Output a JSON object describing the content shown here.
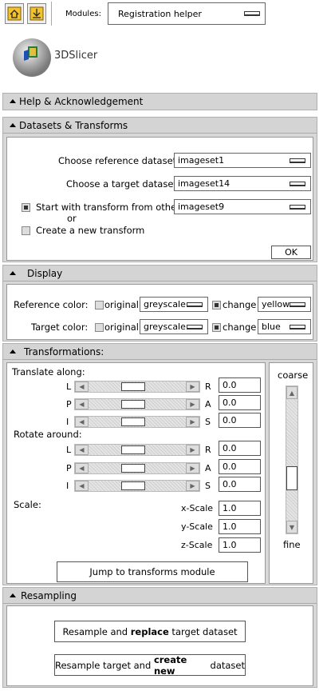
{
  "toolbar": {
    "home_icon": "home-icon",
    "save_icon": "save-icon",
    "modules_label": "Modules:",
    "modules_value": "Registration helper"
  },
  "logo": {
    "text": "3DSlicer"
  },
  "sections": {
    "help": {
      "title": "Help & Acknowledgement"
    },
    "datasets": {
      "title": "Datasets & Transforms",
      "ref_label": "Choose reference dataset:",
      "ref_value": "imageset1",
      "target_label": "Choose a target dataset:",
      "target_value": "imageset14",
      "start_label": "Start with transform from other:",
      "start_value": "imageset9",
      "or_label": "or",
      "create_label": "Create a new transform",
      "ok_label": "OK"
    },
    "display": {
      "title": "Display",
      "ref_color_label": "Reference color:",
      "target_color_label": "Target color:",
      "original_label": "original",
      "change_label": "change",
      "ref_original_value": "greyscale",
      "ref_change_value": "yellow",
      "target_original_value": "greyscale",
      "target_change_value": "blue"
    },
    "transformations": {
      "title": "Transformations:",
      "translate_label": "Translate along:",
      "rotate_label": "Rotate around:",
      "scale_label": "Scale:",
      "translate": [
        {
          "left": "L",
          "right": "R",
          "value": "0.0"
        },
        {
          "left": "P",
          "right": "A",
          "value": "0.0"
        },
        {
          "left": "I",
          "right": "S",
          "value": "0.0"
        }
      ],
      "rotate": [
        {
          "left": "L",
          "right": "R",
          "value": "0.0"
        },
        {
          "left": "P",
          "right": "A",
          "value": "0.0"
        },
        {
          "left": "I",
          "right": "S",
          "value": "0.0"
        }
      ],
      "scales": [
        {
          "label": "x-Scale",
          "value": "1.0"
        },
        {
          "label": "y-Scale",
          "value": "1.0"
        },
        {
          "label": "z-Scale",
          "value": "1.0"
        }
      ],
      "coarse_label": "coarse",
      "fine_label": "fine",
      "jump_label": "Jump to transforms module"
    },
    "resampling": {
      "title": "Resampling",
      "replace_pre": "Resample and ",
      "replace_bold": "replace",
      "replace_post": " target dataset",
      "create_pre": "Resample target and ",
      "create_bold": "create new",
      "create_post": " dataset"
    }
  }
}
